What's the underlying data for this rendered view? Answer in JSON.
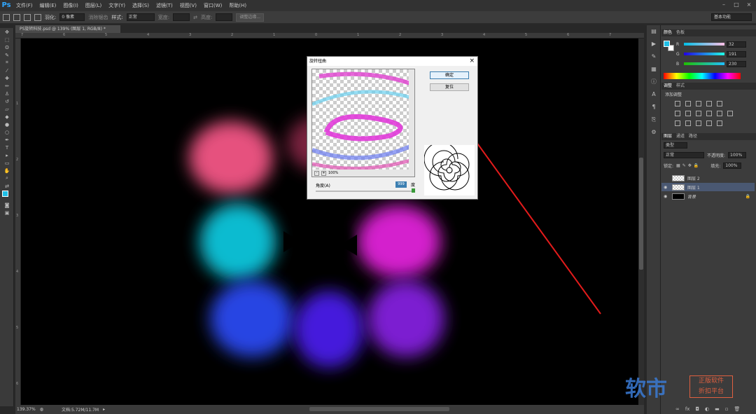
{
  "app": {
    "logo": "Ps"
  },
  "menu": [
    "文件(F)",
    "编辑(E)",
    "图像(I)",
    "图层(L)",
    "文字(Y)",
    "选择(S)",
    "滤镜(T)",
    "视图(V)",
    "窗口(W)",
    "帮助(H)"
  ],
  "window_controls": [
    "–",
    "□",
    "×"
  ],
  "options": {
    "feather_label": "羽化:",
    "feather_value": "0 像素",
    "antialias_label": "消除锯齿",
    "style_label": "样式:",
    "style_value": "正常",
    "width_label": "宽度:",
    "height_label": "高度:",
    "refine_label": "调整边缘...",
    "workspace": "基本功能"
  },
  "document": {
    "tab": "PS旋转科技.psd @ 139% (图层 1, RGB/8) *",
    "status_zoom": "139.37%",
    "status_doc": "文档:5.72M/11.7M",
    "ruler_top": [
      "7",
      "6",
      "5",
      "4",
      "3",
      "2",
      "1",
      "0",
      "1",
      "2",
      "3",
      "4",
      "5",
      "6",
      "7"
    ],
    "ruler_left": [
      "1",
      "2",
      "3",
      "4",
      "5",
      "6"
    ]
  },
  "dialog": {
    "title": "旋转扭曲",
    "close": "×",
    "ok": "确定",
    "reset": "复位",
    "zoom": "100%",
    "angle_label": "角度(A)",
    "angle_value": "999",
    "angle_unit": "度"
  },
  "color_panel": {
    "tabs": [
      "颜色",
      "色板"
    ],
    "r_label": "R",
    "r_value": "32",
    "g_label": "G",
    "g_value": "191",
    "b_label": "B",
    "b_value": "230",
    "foreground": "#20bfe6"
  },
  "adjustments": {
    "tabs": [
      "调整",
      "样式"
    ],
    "title": "添加调整"
  },
  "layers": {
    "tabs": [
      "图层",
      "通道",
      "路径"
    ],
    "kind": "类型",
    "blend": "正常",
    "opacity_label": "不透明度:",
    "opacity": "100%",
    "lock_label": "锁定:",
    "fill_label": "填充:",
    "fill": "100%",
    "items": [
      {
        "name": "图层 2",
        "selected": false,
        "thumb": "checker"
      },
      {
        "name": "图层 1",
        "selected": true,
        "thumb": "checker"
      },
      {
        "name": "背景",
        "selected": false,
        "thumb": "black"
      }
    ]
  },
  "watermark": {
    "main": "软市",
    "line1": "正版软件",
    "line2": "折扣平台"
  }
}
